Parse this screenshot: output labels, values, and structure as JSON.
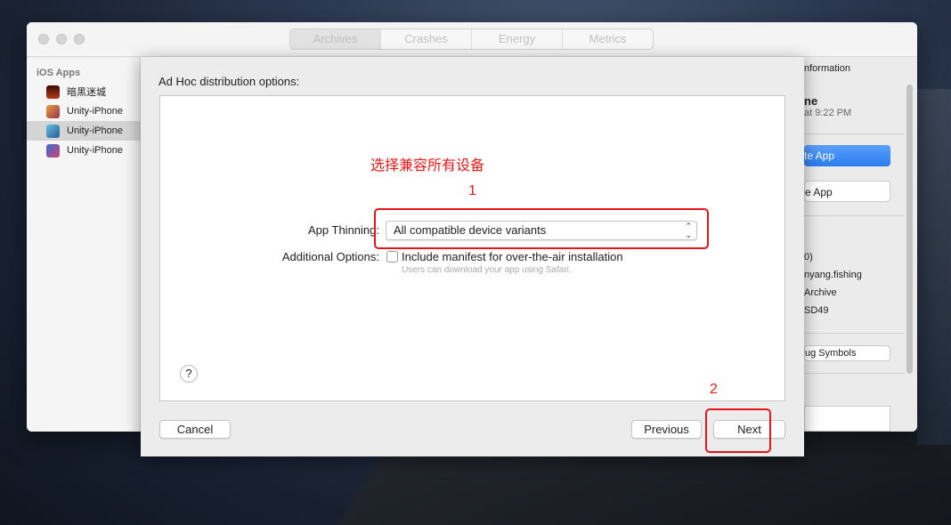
{
  "window": {
    "tabs": [
      {
        "label": "Archives",
        "selected": true
      },
      {
        "label": "Crashes"
      },
      {
        "label": "Energy"
      },
      {
        "label": "Metrics"
      }
    ]
  },
  "sidebar": {
    "header": "iOS Apps",
    "items": [
      {
        "label": "暗黑迷城",
        "icon_color": "#8a1d12"
      },
      {
        "label": "Unity-iPhone",
        "icon_color": "#c0603a"
      },
      {
        "label": "Unity-iPhone",
        "icon_color": "#3a8fc0",
        "selected": true
      },
      {
        "label": "Unity-iPhone",
        "icon_color": "#2a5fb0"
      }
    ]
  },
  "right_panel": {
    "header": "nformation",
    "name": "ne",
    "date": "at 9:22 PM",
    "primary_button": "te App",
    "secondary_button": "e App",
    "fields": [
      "0)",
      "nyang.fishing",
      "Archive",
      "SD49"
    ],
    "debug_button": "ug Symbols"
  },
  "sheet": {
    "title": "Ad Hoc distribution options:",
    "app_thinning_label": "App Thinning:",
    "app_thinning_value": "All compatible device variants",
    "additional_options_label": "Additional Options:",
    "manifest_checkbox_label": "Include manifest for over-the-air installation",
    "manifest_checked": false,
    "manifest_hint": "Users can download your app using Safari.",
    "help": "?",
    "cancel": "Cancel",
    "previous": "Previous",
    "next": "Next"
  },
  "annotations": {
    "note": "选择兼容所有设备",
    "step1": "1",
    "step2": "2",
    "color": "#f21818"
  }
}
